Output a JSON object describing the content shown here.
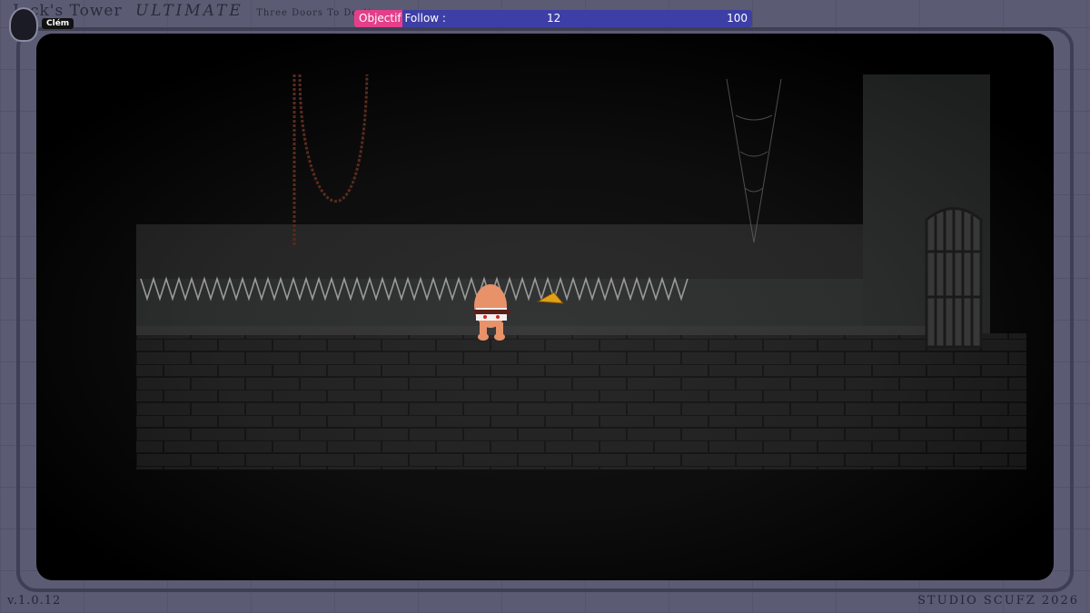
{
  "game": {
    "title": "Tower",
    "title_prefix": "Jack's",
    "mode": "ULTIMATE",
    "subtitle": "Three Doors To Destiny"
  },
  "player": {
    "name": "Clém"
  },
  "objective": {
    "label": "Objectif Follow :",
    "current": "12",
    "target": "100",
    "progress_fraction": 0.12,
    "fill_color": "#e43f8a",
    "track_color": "#3d3fa6"
  },
  "footer": {
    "version": "v.1.0.12",
    "studio": "STUDIO SCUFZ 2026"
  },
  "colors": {
    "frame": "#5b5b74",
    "stage": "#000000",
    "wall": "#2e2e2e",
    "floor": "#242424"
  },
  "icons": {
    "avatar": "hooded-figure-icon",
    "gate": "iron-gate-icon",
    "spikes": "ceiling-spikes-icon",
    "chains": "hanging-chain-icon",
    "cobweb": "cobweb-icon"
  }
}
